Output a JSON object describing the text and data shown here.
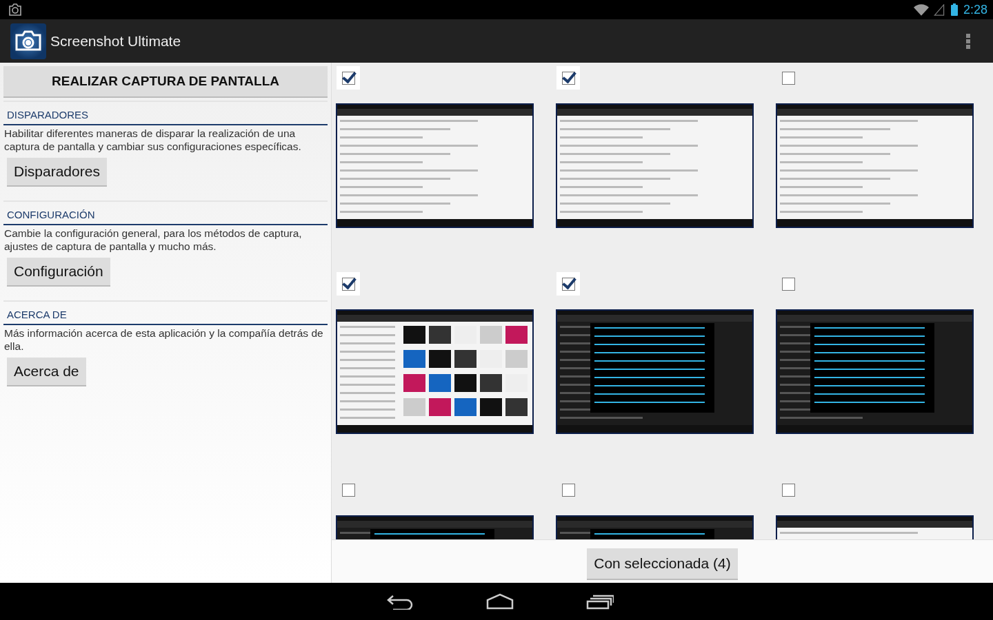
{
  "status_bar": {
    "time": "2:28"
  },
  "action_bar": {
    "title": "Screenshot Ultimate"
  },
  "capture_button": "REALIZAR CAPTURA DE PANTALLA",
  "sections": [
    {
      "heading": "DISPARADORES",
      "description": "Habilitar diferentes maneras de disparar la realización de una captura de pantalla y cambiar sus configuraciones específicas.",
      "button": "Disparadores"
    },
    {
      "heading": "CONFIGURACIÓN",
      "description": "Cambie la configuración general, para los métodos de captura, ajustes de captura de pantalla y mucho más.",
      "button": "Configuración"
    },
    {
      "heading": "ACERCA DE",
      "description": "Más información acerca de esta aplicación y la compañía detrás de ella.",
      "button": "Acerca de"
    }
  ],
  "screenshots": [
    {
      "kind": "light",
      "checked": true
    },
    {
      "kind": "light",
      "checked": true
    },
    {
      "kind": "light",
      "checked": false
    },
    {
      "kind": "grid",
      "checked": true
    },
    {
      "kind": "dark",
      "checked": true
    },
    {
      "kind": "dark",
      "checked": false
    },
    {
      "kind": "dark",
      "checked": false
    },
    {
      "kind": "dark",
      "checked": false
    },
    {
      "kind": "light",
      "checked": false
    }
  ],
  "action_button": "Con seleccionada (4)"
}
